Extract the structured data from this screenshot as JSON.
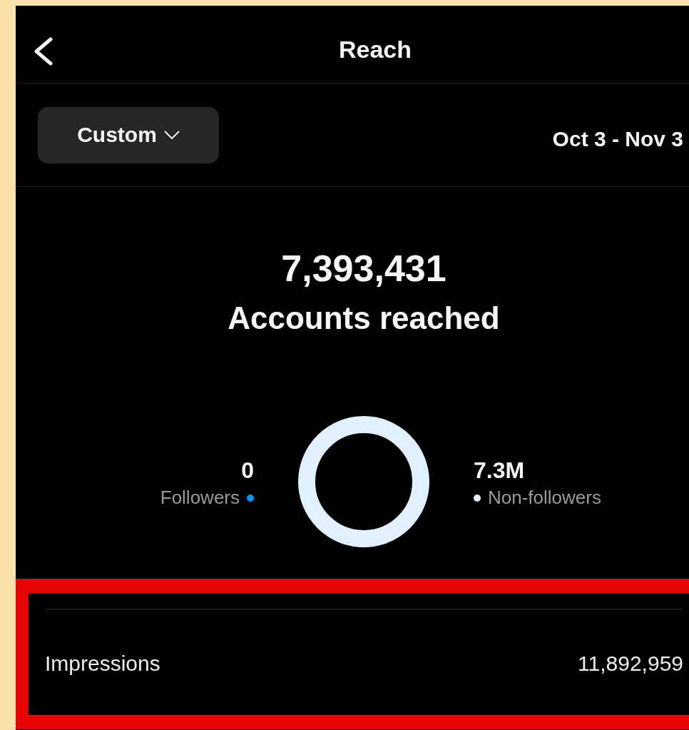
{
  "header": {
    "title": "Reach"
  },
  "range": {
    "preset": "Custom",
    "dates": "Oct 3 - Nov 3"
  },
  "summary": {
    "total": "7,393,431",
    "label": "Accounts reached"
  },
  "legend": [
    {
      "value": "0",
      "label": "Followers",
      "color": "#0095f6"
    },
    {
      "value": "7.3M",
      "label": "Non-followers",
      "color": "#e0f1fd"
    }
  ],
  "metrics": [
    {
      "label": "Impressions",
      "value": "11,892,959",
      "highlighted": true
    }
  ]
}
